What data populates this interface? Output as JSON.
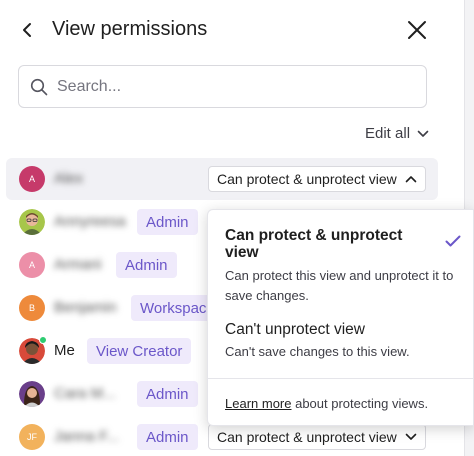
{
  "header": {
    "title": "View permissions"
  },
  "search": {
    "placeholder": "Search..."
  },
  "edit_all_label": "Edit all",
  "rows": [
    {
      "initials": "A",
      "avatar_color": "#c63a6a",
      "name": "Alex",
      "permission": "Can protect & unprotect view"
    },
    {
      "initials": "",
      "name": "Annyreesa",
      "badge": "Admin"
    },
    {
      "initials": "A",
      "avatar_color": "#ec8fa8",
      "name": "Armani",
      "badge": "Admin"
    },
    {
      "initials": "B",
      "avatar_color": "#ee8a3b",
      "name": "Benjamin",
      "badge": "Workspace"
    },
    {
      "initials": "",
      "name": "Me",
      "badge": "View Creator"
    },
    {
      "initials": "",
      "name": "Cara M...",
      "badge": "Admin"
    },
    {
      "initials": "JF",
      "avatar_color": "#f2b25c",
      "name": "Janna F...",
      "badge": "Admin",
      "permission": "Can protect & unprotect view"
    }
  ],
  "dropdown": {
    "option1": {
      "title": "Can protect & unprotect view",
      "desc": "Can protect this view and unprotect it to save changes."
    },
    "option2": {
      "title": "Can't unprotect view",
      "desc": "Can't save changes to this view."
    },
    "learn_more_link": "Learn more",
    "learn_more_rest": " about protecting views."
  },
  "colors": {
    "accent": "#6b57c9",
    "badge_bg": "#efeafb"
  }
}
